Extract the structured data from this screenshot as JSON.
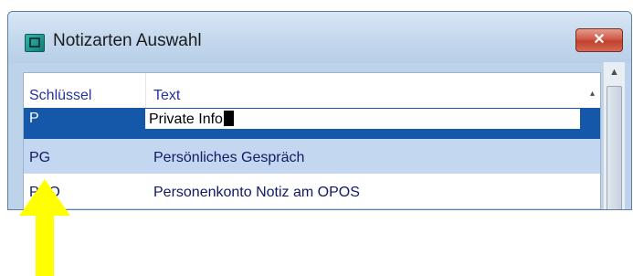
{
  "window": {
    "title": "Notizarten Auswahl",
    "close_label": "✕",
    "app_icon": "app-icon"
  },
  "grid": {
    "columns": [
      "Schlüssel",
      "Text"
    ],
    "rows": [
      {
        "key": "P",
        "text": "Private Info",
        "state": "selected-editing"
      },
      {
        "key": "PG",
        "text": "Persönliches Gespräch",
        "state": "alternate"
      },
      {
        "key": "PKO",
        "text": "Personenkonto Notiz am OPOS",
        "state": "normal"
      }
    ]
  },
  "scrollbar": {
    "up_arrow": "▲"
  },
  "annotation": {
    "type": "arrow",
    "color": "#ffff00"
  },
  "colors": {
    "selection": "#1558aa",
    "alternate_row": "#c4d7f1",
    "header_text": "#2233a3",
    "close_button": "#c1402b"
  }
}
